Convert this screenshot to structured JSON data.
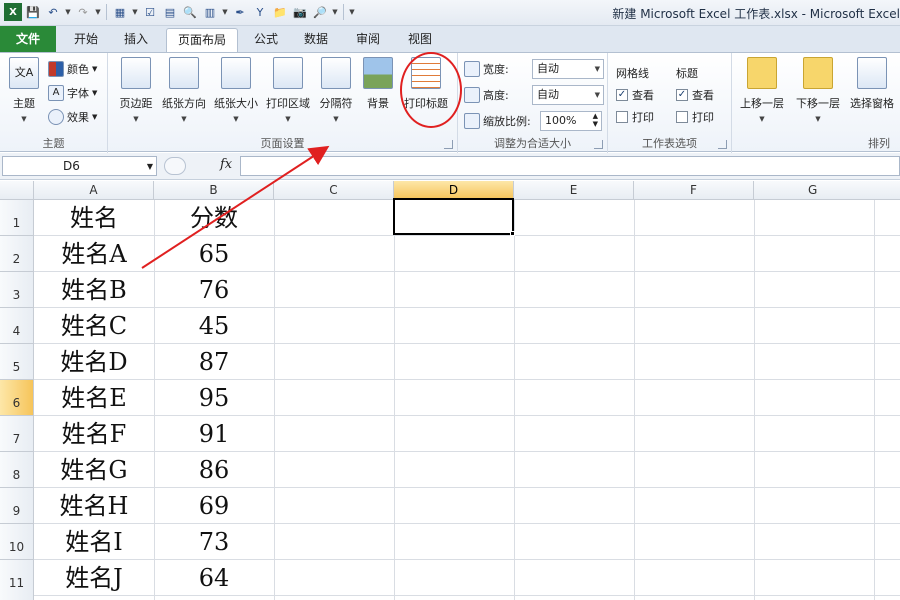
{
  "window": {
    "title": "新建 Microsoft Excel 工作表.xlsx - Microsoft Excel"
  },
  "qat": {
    "icons": [
      "save-icon",
      "undo-icon",
      "redo-icon",
      "form-icon",
      "spell-icon",
      "print-preview-icon",
      "table-icon",
      "brush-icon",
      "filter-icon",
      "folder-icon",
      "camera-icon",
      "find-icon",
      "customize-icon"
    ]
  },
  "tabs": [
    "文件",
    "开始",
    "插入",
    "页面布局",
    "公式",
    "数据",
    "审阅",
    "视图"
  ],
  "active_tab": "页面布局",
  "ribbon": {
    "theme": {
      "group": "主题",
      "themes": "主题",
      "colors": "颜色",
      "fonts": "字体",
      "effects": "效果"
    },
    "page_setup": {
      "group": "页面设置",
      "margins": "页边距",
      "orientation": "纸张方向",
      "size": "纸张大小",
      "print_area": "打印区域",
      "breaks": "分隔符",
      "background": "背景",
      "print_titles": "打印标题"
    },
    "scale": {
      "group": "调整为合适大小",
      "width_label": "宽度:",
      "width_value": "自动",
      "height_label": "高度:",
      "height_value": "自动",
      "scale_label": "缩放比例:",
      "scale_value": "100%"
    },
    "sheet_options": {
      "group": "工作表选项",
      "gridlines": "网格线",
      "headings": "标题",
      "view": "查看",
      "print": "打印",
      "gridlines_view": true,
      "gridlines_print": false,
      "headings_view": true,
      "headings_print": false
    },
    "arrange": {
      "group": "排列",
      "bring_forward": "上移一层",
      "send_backward": "下移一层",
      "selection_pane": "选择窗格"
    }
  },
  "formula_bar": {
    "name_box": "D6",
    "fx": "fx",
    "content": ""
  },
  "grid": {
    "columns": [
      "A",
      "B",
      "C",
      "D",
      "E",
      "F",
      "G"
    ],
    "rows": [
      "1",
      "2",
      "3",
      "4",
      "5",
      "6",
      "7",
      "8",
      "9",
      "10",
      "11"
    ],
    "selected_cell": "D6",
    "data": [
      [
        "姓名",
        "分数"
      ],
      [
        "姓名A",
        "65"
      ],
      [
        "姓名B",
        "76"
      ],
      [
        "姓名C",
        "45"
      ],
      [
        "姓名D",
        "87"
      ],
      [
        "姓名E",
        "95"
      ],
      [
        "姓名F",
        "91"
      ],
      [
        "姓名G",
        "86"
      ],
      [
        "姓名H",
        "69"
      ],
      [
        "姓名I",
        "73"
      ],
      [
        "姓名J",
        "64"
      ]
    ]
  },
  "annotations": {
    "arrow_color": "#e02020",
    "circle_color": "#e02020"
  }
}
